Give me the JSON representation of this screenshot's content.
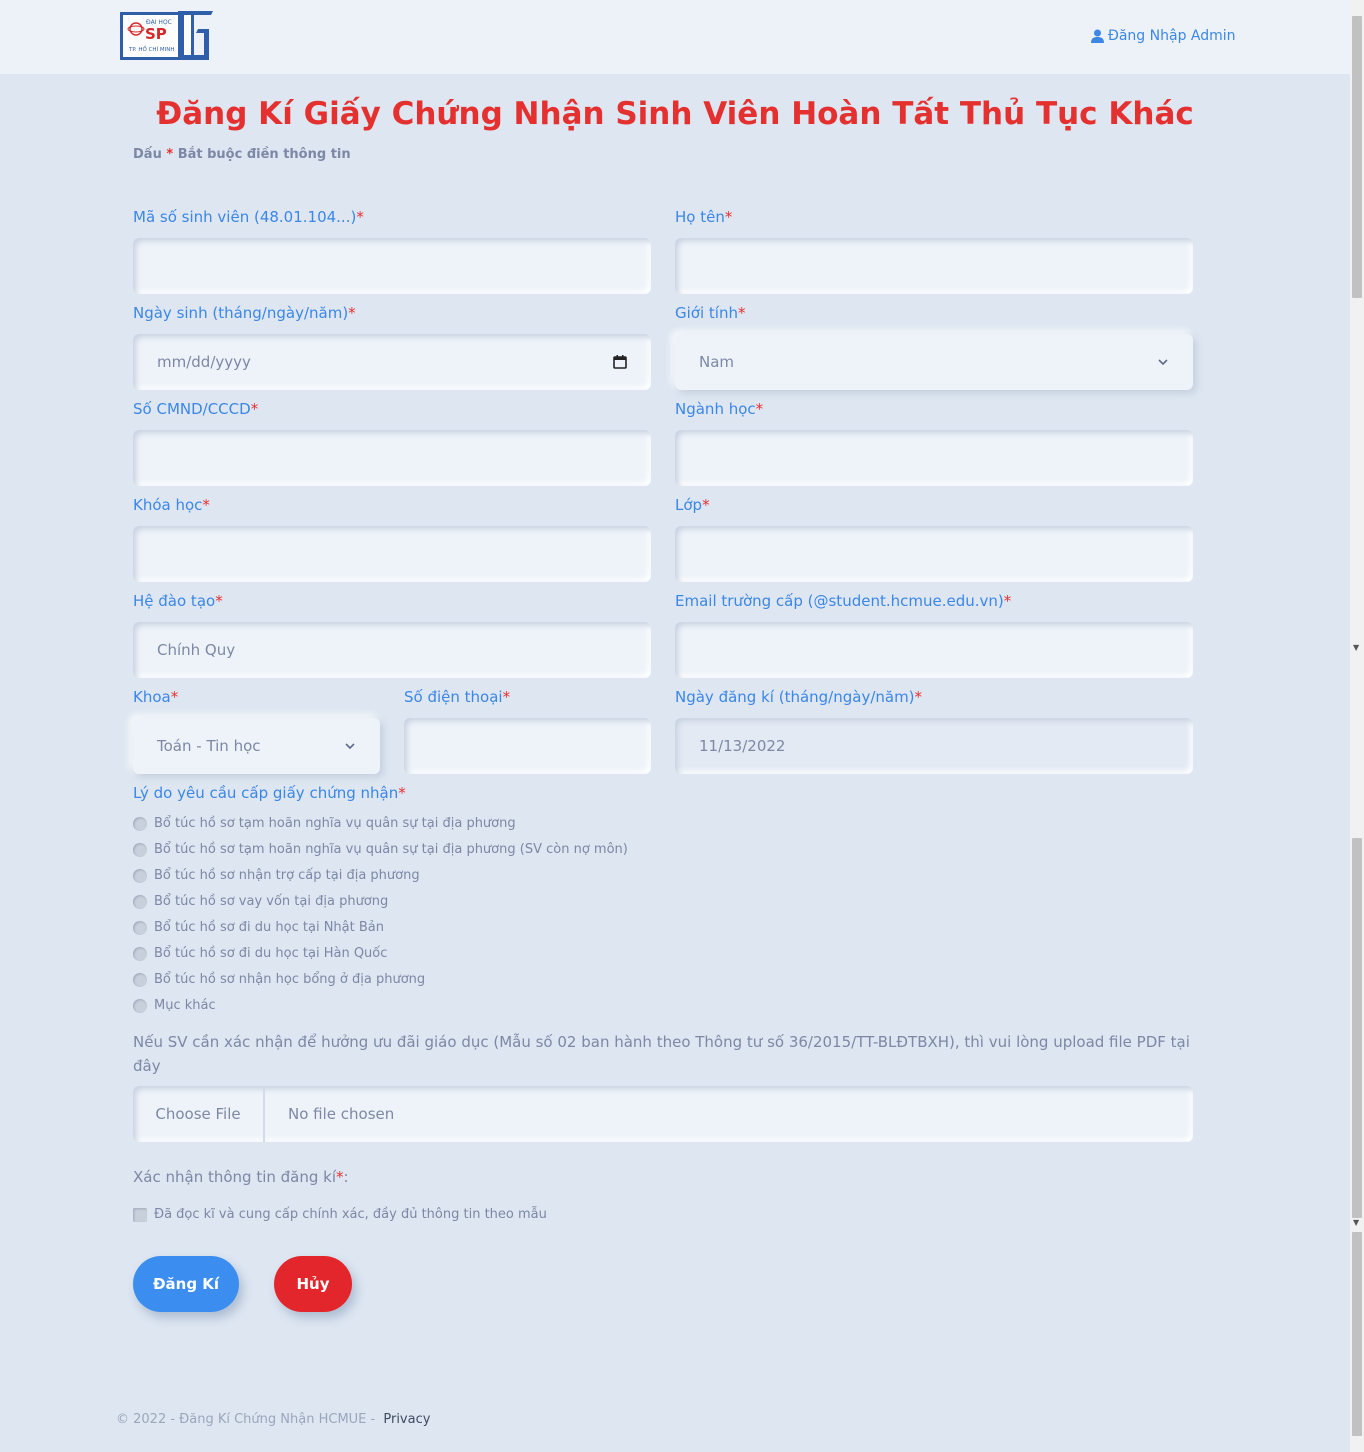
{
  "header": {
    "logo_top": "ĐẠI HỌC",
    "logo_main": "SP",
    "logo_bottom": "TP. HỒ CHÍ MINH",
    "admin_login": "Đăng Nhập Admin"
  },
  "page": {
    "title": "Đăng Kí Giấy Chứng Nhận Sinh Viên Hoàn Tất Thủ Tục Khác",
    "req_note_prefix": "Dấu",
    "req_note_star": "*",
    "req_note_suffix": "Bắt buộc điền thông tin"
  },
  "form": {
    "student_id_label": "Mã số sinh viên (48.01.104...)",
    "student_id_value": "",
    "fullname_label": "Họ tên",
    "fullname_value": "",
    "dob_label": "Ngày sinh (tháng/ngày/năm)",
    "dob_placeholder": "mm/dd/yyyy",
    "gender_label": "Giới tính",
    "gender_selected": "Nam",
    "id_card_label": "Số CMND/CCCD",
    "id_card_value": "",
    "major_label": "Ngành học",
    "major_value": "",
    "course_label": "Khóa học",
    "course_value": "",
    "class_label": "Lớp",
    "class_value": "",
    "program_label": "Hệ đào tạo",
    "program_value": "Chính Quy",
    "email_label": "Email trường cấp (@student.hcmue.edu.vn)",
    "email_value": "",
    "faculty_label": "Khoa",
    "faculty_selected": "Toán - Tin học",
    "phone_label": "Số điện thoại",
    "phone_value": "",
    "reg_date_label": "Ngày đăng kí (tháng/ngày/năm)",
    "reg_date_value": "11/13/2022",
    "reason_label": "Lý do yêu cầu cấp giấy chứng nhận",
    "reasons": [
      "Bổ túc hồ sơ tạm hoãn nghĩa vụ quân sự tại địa phương",
      "Bổ túc hồ sơ tạm hoãn nghĩa vụ quân sự tại địa phương (SV còn nợ môn)",
      "Bổ túc hồ sơ nhận trợ cấp tại địa phương",
      "Bổ túc hồ sơ vay vốn tại địa phương",
      "Bổ túc hồ sơ đi du học tại Nhật Bản",
      "Bổ túc hồ sơ đi du học tại Hàn Quốc",
      "Bổ túc hồ sơ nhận học bổng ở địa phương",
      "Mục khác"
    ],
    "upload_note": "Nếu SV cần xác nhận để hưởng ưu đãi giáo dục (Mẫu số 02 ban hành theo Thông tư số 36/2015/TT-BLĐTBXH), thì vui lòng upload file PDF tại đây",
    "file_button": "Choose File",
    "file_status": "No file chosen",
    "confirm_label": "Xác nhận thông tin đăng kí",
    "confirm_colon": ":",
    "confirm_checkbox": "Đã đọc kĩ và cung cấp chính xác, đầy đủ thông tin theo mẫu",
    "required_mark": "*"
  },
  "actions": {
    "submit": "Đăng Kí",
    "cancel": "Hủy"
  },
  "footer": {
    "copyright": "© 2022 - Đăng Kí Chứng Nhận HCMUE -",
    "privacy": "Privacy"
  },
  "colors": {
    "accent": "#3b87e6",
    "danger": "#e53030",
    "background": "#dde6f1"
  }
}
